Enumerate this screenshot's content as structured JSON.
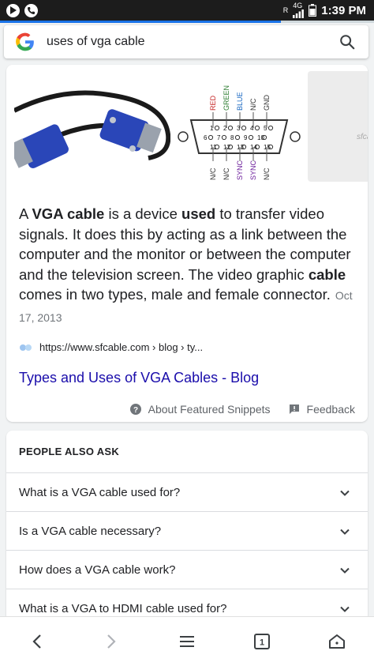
{
  "status_bar": {
    "time": "1:39 PM",
    "network": "4G",
    "roaming": "R",
    "icons": [
      "play-circle-icon",
      "phone-circle-icon",
      "signal-icon",
      "battery-icon"
    ]
  },
  "progress": {
    "fraction": 0.75,
    "color": "#1a73e8"
  },
  "search": {
    "query": "uses of vga cable",
    "icons": [
      "google-logo",
      "search-icon"
    ]
  },
  "featured_snippet": {
    "images": {
      "pinout": {
        "top_labels": [
          "RED",
          "GREEN",
          "BLUE",
          "N/C",
          "GND"
        ],
        "row1": [
          "1",
          "2",
          "3",
          "4",
          "5"
        ],
        "row2": [
          "6",
          "7",
          "8",
          "9",
          "10"
        ],
        "row3": [
          "11",
          "12",
          "13",
          "14",
          "15"
        ],
        "bottom_labels": [
          "N/C",
          "N/C",
          "SYNC",
          "SYNC",
          "N/C"
        ]
      },
      "watermark": "sfcab"
    },
    "text_parts": [
      "A ",
      "VGA cable",
      " is a device ",
      "used",
      " to transfer video signals. It does this by acting as a link between the computer and the monitor or between the computer and the television screen. The video graphic ",
      "cable",
      " comes in two types, male and female connector."
    ],
    "date": "Oct 17, 2013",
    "source_url": "https://www.sfcable.com › blog › ty...",
    "link_title": "Types and Uses of VGA Cables - Blog",
    "about_label": "About Featured Snippets",
    "feedback_label": "Feedback"
  },
  "people_also_ask": {
    "title": "PEOPLE ALSO ASK",
    "questions": [
      "What is a VGA cable used for?",
      "Is a VGA cable necessary?",
      "How does a VGA cable work?",
      "What is a VGA to HDMI cable used for?"
    ]
  },
  "bottom_nav": {
    "tab_count": "1",
    "icons": [
      "back-icon",
      "forward-icon",
      "menu-icon",
      "tabs-icon",
      "home-icon"
    ]
  }
}
